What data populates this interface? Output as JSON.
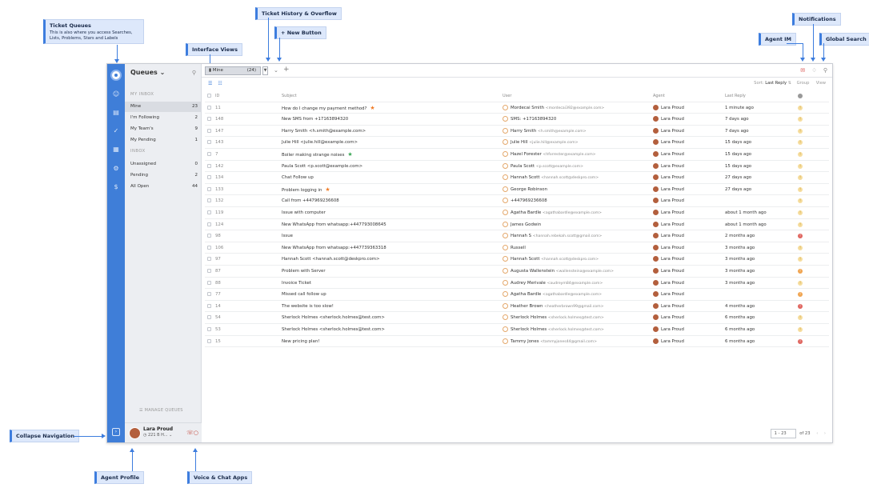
{
  "callouts": {
    "ticket_queues": "Ticket Queues",
    "ticket_queues_desc": "This is also where you access Searches, Lists, Problems, Stars and Labels",
    "interface_views": "Interface Views",
    "ticket_history": "Ticket History & Overflow",
    "new_button": "+ New Button",
    "notifications": "Notifications",
    "agent_im": "Agent IM",
    "global_search": "Global Search",
    "collapse_navigation": "Collapse Navigation",
    "agent_profile": "Agent Profile",
    "voice_chat": "Voice & Chat Apps"
  },
  "queues": {
    "title": "Queues",
    "my_inbox": "MY INBOX",
    "inbox": "INBOX",
    "my_items": [
      {
        "label": "Mine",
        "count": "23"
      },
      {
        "label": "I'm Following",
        "count": "2"
      },
      {
        "label": "My Team's",
        "count": "9"
      },
      {
        "label": "My Pending",
        "count": "1"
      }
    ],
    "inbox_items": [
      {
        "label": "Unassigned",
        "count": "0"
      },
      {
        "label": "Pending",
        "count": "2"
      },
      {
        "label": "All Open",
        "count": "44"
      }
    ],
    "manage": "MANAGE QUEUES"
  },
  "profile": {
    "name": "Lara Proud",
    "status": "221 B H..."
  },
  "tab": {
    "label": "Mine",
    "count": "(24)"
  },
  "sort": {
    "label": "Sort:",
    "value": "Last Reply",
    "group": "Group",
    "view": "View"
  },
  "columns": {
    "id": "ID",
    "subject": "Subject",
    "user": "User",
    "agent": "Agent",
    "last_reply": "Last Reply"
  },
  "tickets": [
    {
      "id": "11",
      "subject": "How do I change my payment method?",
      "star": "orange",
      "user": "Mordecai Smith",
      "email": "<mordecai392@example.com>",
      "agent": "Lara Proud",
      "last": "1 minute ago",
      "status": "yellow"
    },
    {
      "id": "148",
      "subject": "New SMS from +17163894320",
      "star": "",
      "user": "SMS: +17163894320",
      "email": "",
      "agent": "Lara Proud",
      "last": "7 days ago",
      "status": "yellow"
    },
    {
      "id": "147",
      "subject": "Harry Smith <h.smith@example.com>",
      "star": "",
      "user": "Harry Smith",
      "email": "<h.smith@example.com>",
      "agent": "Lara Proud",
      "last": "7 days ago",
      "status": "yellow"
    },
    {
      "id": "143",
      "subject": "Julie Hill <julie.hill@example.com>",
      "star": "",
      "user": "Julie Hill",
      "email": "<julie.hill@example.com>",
      "agent": "Lara Proud",
      "last": "15 days ago",
      "status": "yellow"
    },
    {
      "id": "7",
      "subject": "Boiler making strange noises",
      "star": "green",
      "user": "Hazel Forester",
      "email": "<hforrester@example.com>",
      "agent": "Lara Proud",
      "last": "15 days ago",
      "status": "yellow"
    },
    {
      "id": "142",
      "subject": "Paula Scott <p.scott@example.com>",
      "star": "",
      "user": "Paula Scott",
      "email": "<p.scott@example.com>",
      "agent": "Lara Proud",
      "last": "15 days ago",
      "status": "yellow"
    },
    {
      "id": "134",
      "subject": "Chat Follow up",
      "star": "",
      "user": "Hannah Scott",
      "email": "<hannah.scott@deskpro.com>",
      "agent": "Lara Proud",
      "last": "27 days ago",
      "status": "yellow"
    },
    {
      "id": "133",
      "subject": "Problem logging in",
      "star": "orange",
      "user": "George Robinson",
      "email": "",
      "agent": "Lara Proud",
      "last": "27 days ago",
      "status": "yellow"
    },
    {
      "id": "132",
      "subject": "Call from +447969236608",
      "star": "",
      "user": "+447969236608",
      "email": "",
      "agent": "Lara Proud",
      "last": "",
      "status": "yellow"
    },
    {
      "id": "119",
      "subject": "Issue with computer",
      "star": "",
      "user": "Agatha Bardle",
      "email": "<agathabardle@example.com>",
      "agent": "Lara Proud",
      "last": "about 1 month ago",
      "status": "yellow"
    },
    {
      "id": "124",
      "subject": "New WhatsApp from whatsapp:+447793008645",
      "star": "",
      "user": "James Godwin",
      "email": "",
      "agent": "Lara Proud",
      "last": "about 1 month ago",
      "status": "yellow"
    },
    {
      "id": "98",
      "subject": "Issue",
      "star": "",
      "user": "Hannah S",
      "email": "<hannah.rebekah.scott@gmail.com>",
      "agent": "Lara Proud",
      "last": "2 months ago",
      "status": "red"
    },
    {
      "id": "106",
      "subject": "New WhatsApp from whatsapp:+447739363318",
      "star": "",
      "user": "Russell",
      "email": "",
      "agent": "Lara Proud",
      "last": "3 months ago",
      "status": "yellow"
    },
    {
      "id": "97",
      "subject": "Hannah Scott <hannah.scott@deskpro.com>",
      "star": "",
      "user": "Hannah Scott",
      "email": "<hannah.scott@deskpro.com>",
      "agent": "Lara Proud",
      "last": "3 months ago",
      "status": "yellow"
    },
    {
      "id": "87",
      "subject": "Problem with Server",
      "star": "",
      "user": "Augusta Wallenstein",
      "email": "<wallensteina@example.com>",
      "agent": "Lara Proud",
      "last": "3 months ago",
      "status": "orange"
    },
    {
      "id": "88",
      "subject": "Invoice Ticket",
      "star": "",
      "user": "Audrey Merivale",
      "email": "<audreym84@example.com>",
      "agent": "Lara Proud",
      "last": "3 months ago",
      "status": "yellow"
    },
    {
      "id": "77",
      "subject": "Missed call follow up",
      "star": "",
      "user": "Agatha Bardle",
      "email": "<agathabardle@example.com>",
      "agent": "Lara Proud",
      "last": "",
      "status": "orange"
    },
    {
      "id": "14",
      "subject": "The website is too slow!",
      "star": "",
      "user": "Heather Brown",
      "email": "<heatherbrown99@gmail.com>",
      "agent": "Lara Proud",
      "last": "4 months ago",
      "status": "red"
    },
    {
      "id": "54",
      "subject": "Sherlock Holmes <sherlock.holmes@test.com>",
      "star": "",
      "user": "Sherlock Holmes",
      "email": "<sherlock.holmes@test.com>",
      "agent": "Lara Proud",
      "last": "6 months ago",
      "status": "yellow"
    },
    {
      "id": "53",
      "subject": "Sherlock Holmes <sherlock.holmes@test.com>",
      "star": "",
      "user": "Sherlock Holmes",
      "email": "<sherlock.holmes@test.com>",
      "agent": "Lara Proud",
      "last": "6 months ago",
      "status": "yellow"
    },
    {
      "id": "15",
      "subject": "New pricing plan!",
      "star": "",
      "user": "Tammy Jones",
      "email": "<tammyjones44@gmail.com>",
      "agent": "Lara Proud",
      "last": "6 months ago",
      "status": "red"
    }
  ],
  "pager": {
    "range": "1 - 23",
    "of": "of 23"
  },
  "colors": {
    "accent": "#3f7ed8",
    "callout": "#dde8fb",
    "star_orange": "#f07d2a",
    "star_green": "#3aa655"
  }
}
